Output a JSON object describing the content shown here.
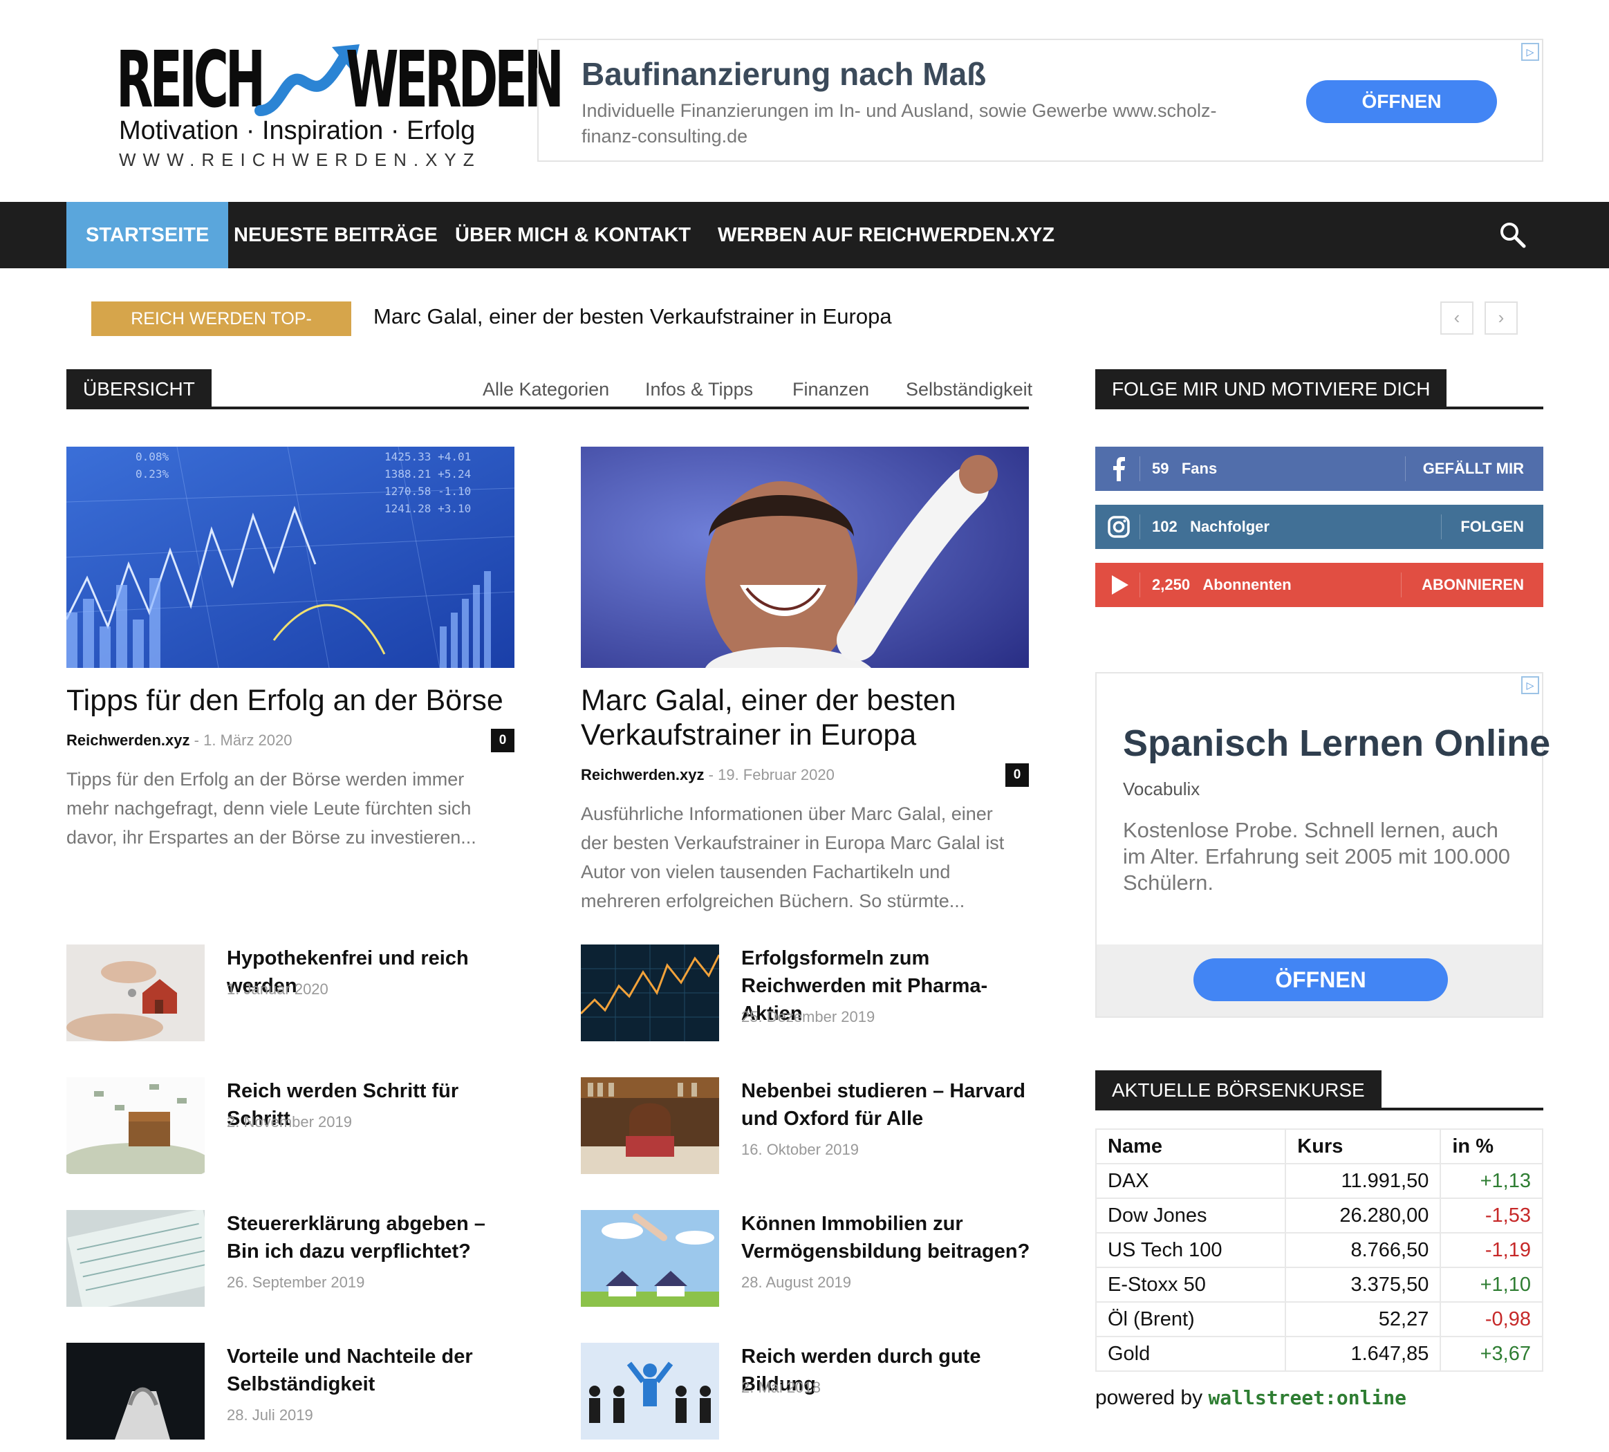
{
  "header": {
    "logo_left": "REICH",
    "logo_right": "WERDEN",
    "tagline": "Motivation · Inspiration · Erfolg",
    "url": "WWW.REICHWERDEN.XYZ"
  },
  "top_ad": {
    "headline": "Baufinanzierung nach Maß",
    "text": "Individuelle Finanzierungen im In- und Ausland, sowie Gewerbe www.scholz-finanz-consulting.de",
    "button": "ÖFFNEN",
    "adchoice_icon": "adchoices-icon"
  },
  "nav": {
    "items": [
      "STARTSEITE",
      "NEUESTE BEITRÄGE",
      "ÜBER MICH & KONTAKT",
      "WERBEN AUF REICHWERDEN.XYZ"
    ],
    "active_color": "#5aa6dc",
    "search_icon": "search-icon"
  },
  "ticker": {
    "label": "REICH WERDEN TOP-BEITRÄGE",
    "text": "Marc Galal, einer der besten Verkaufstrainer in Europa",
    "prev": "‹",
    "next": "›"
  },
  "overview": {
    "title": "ÜBERSICHT",
    "categories": [
      "Alle Kategorien",
      "Infos & Tipps",
      "Finanzen",
      "Selbständigkeit"
    ]
  },
  "featured": [
    {
      "title": "Tipps für den Erfolg an der Börse",
      "author": "Reichwerden.xyz",
      "date": "1. März 2020",
      "comments": "0",
      "excerpt": "Tipps für den Erfolg an der Börse werden immer mehr nachgefragt, denn viele Leute fürchten sich davor, ihr Erspartes an der Börse zu investieren..."
    },
    {
      "title": "Marc Galal, einer der besten Verkaufstrainer in Europa",
      "author": "Reichwerden.xyz",
      "date": "19. Februar 2020",
      "comments": "0",
      "excerpt": "Ausführliche Informationen über Marc Galal, einer der besten Verkaufstrainer in Europa Marc Galal ist Autor von vielen tausenden Fachartikeln und mehreren erfolgreichen Büchern. So stürmte..."
    }
  ],
  "posts_left": [
    {
      "title": "Hypothekenfrei und reich werden",
      "date": "1. Januar 2020"
    },
    {
      "title": "Reich werden Schritt für Schritt",
      "date": "2. November 2019"
    },
    {
      "title": "Steuererklärung abgeben – Bin ich dazu verpflichtet?",
      "date": "26. September 2019"
    },
    {
      "title": "Vorteile und Nachteile der Selbständigkeit",
      "date": "28. Juli 2019"
    }
  ],
  "posts_right": [
    {
      "title": "Erfolgsformeln zum Reichwerden mit Pharma-Aktien",
      "date": "25. Dezember 2019"
    },
    {
      "title": "Nebenbei studieren – Harvard und Oxford für Alle",
      "date": "16. Oktober 2019"
    },
    {
      "title": "Können Immobilien zur Vermögensbildung beitragen?",
      "date": "28. August 2019"
    },
    {
      "title": "Reich werden durch gute Bildung",
      "date": "2. Mai 2018"
    }
  ],
  "sidebar": {
    "follow_title": "FOLGE MIR UND MOTIVIERE DICH",
    "social": [
      {
        "count": "59",
        "unit": "Fans",
        "action": "GEFÄLLT MIR",
        "color": "#516eab",
        "icon": "facebook-icon"
      },
      {
        "count": "102",
        "unit": "Nachfolger",
        "action": "FOLGEN",
        "color": "#417096",
        "icon": "instagram-icon"
      },
      {
        "count": "2,250",
        "unit": "Abonnenten",
        "action": "ABONNIEREN",
        "color": "#e14e42",
        "icon": "youtube-icon"
      }
    ],
    "ad": {
      "headline": "Spanisch Lernen Online",
      "advertiser": "Vocabulix",
      "text": "Kostenlose Probe. Schnell lernen, auch im Alter. Erfahrung seit 2005 mit 100.000 Schülern.",
      "button": "ÖFFNEN"
    },
    "stocks_title": "AKTUELLE BÖRSENKURSE",
    "stocks": {
      "headers": [
        "Name",
        "Kurs",
        "in %"
      ],
      "rows": [
        {
          "name": "DAX",
          "kurs": "11.991,50",
          "change": "+1,13"
        },
        {
          "name": "Dow Jones",
          "kurs": "26.280,00",
          "change": "-1,53"
        },
        {
          "name": "US Tech 100",
          "kurs": "8.766,50",
          "change": "-1,19"
        },
        {
          "name": "E-Stoxx 50",
          "kurs": "3.375,50",
          "change": "+1,10"
        },
        {
          "name": "Öl (Brent)",
          "kurs": "52,27",
          "change": "-0,98"
        },
        {
          "name": "Gold",
          "kurs": "1.647,85",
          "change": "+3,67"
        }
      ]
    },
    "powered_by": "powered by",
    "powered_brand_a": "wallstreet",
    "powered_brand_b": ":online"
  }
}
